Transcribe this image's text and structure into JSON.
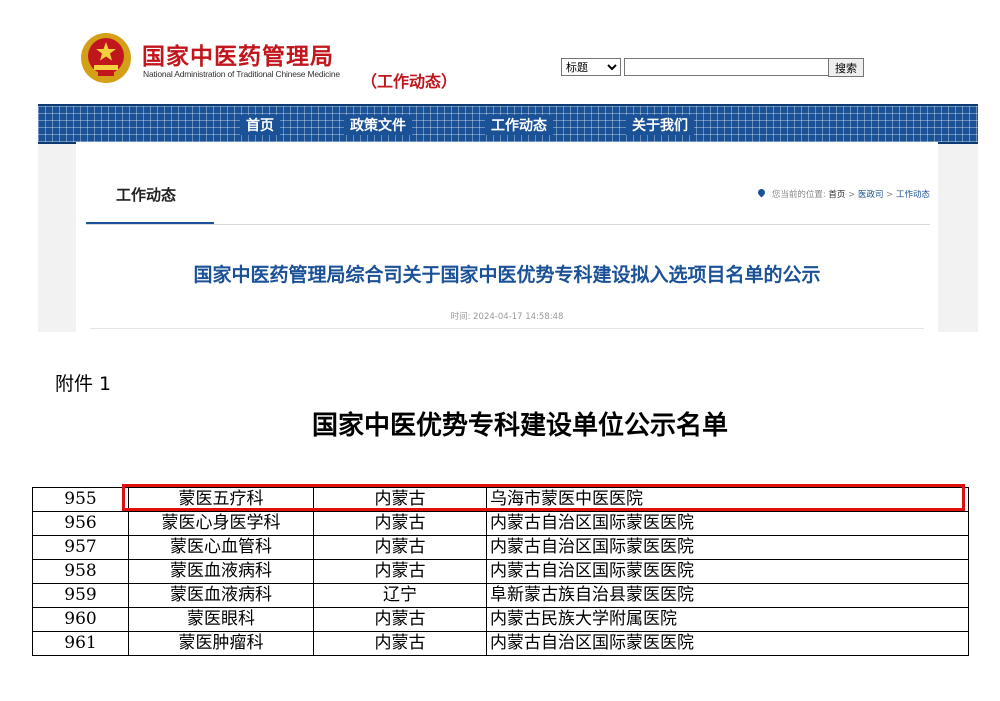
{
  "header": {
    "site_name": "国家中医药管理局",
    "site_name_en": "National Administration of Traditional Chinese Medicine",
    "section_tag": "（工作动态）"
  },
  "search": {
    "select_value": "标题",
    "input_value": "",
    "button_label": "搜索"
  },
  "nav": {
    "items": [
      "首页",
      "政策文件",
      "工作动态",
      "关于我们"
    ]
  },
  "breadcrumb": {
    "section_title": "工作动态",
    "location_prefix": "您当前的位置:",
    "path": [
      "首页",
      "医政司",
      "工作动态"
    ],
    "separator": ">"
  },
  "article": {
    "title": "国家中医药管理局综合司关于国家中医优势专科建设拟入选项目名单的公示",
    "time_label": "时间:",
    "time_value": "2024-04-17 14:58:48"
  },
  "document": {
    "attachment_label": "附件 1",
    "title": "国家中医优势专科建设单位公示名单",
    "rows": [
      {
        "num": "955",
        "dept": "蒙医五疗科",
        "prov": "内蒙古",
        "inst": "乌海市蒙医中医医院"
      },
      {
        "num": "956",
        "dept": "蒙医心身医学科",
        "prov": "内蒙古",
        "inst": "内蒙古自治区国际蒙医医院"
      },
      {
        "num": "957",
        "dept": "蒙医心血管科",
        "prov": "内蒙古",
        "inst": "内蒙古自治区国际蒙医医院"
      },
      {
        "num": "958",
        "dept": "蒙医血液病科",
        "prov": "内蒙古",
        "inst": "内蒙古自治区国际蒙医医院"
      },
      {
        "num": "959",
        "dept": "蒙医血液病科",
        "prov": "辽宁",
        "inst": "阜新蒙古族自治县蒙医医院"
      },
      {
        "num": "960",
        "dept": "蒙医眼科",
        "prov": "内蒙古",
        "inst": "内蒙古民族大学附属医院"
      },
      {
        "num": "961",
        "dept": "蒙医肿瘤科",
        "prov": "内蒙古",
        "inst": "内蒙古自治区国际蒙医医院"
      }
    ]
  },
  "colors": {
    "brand_red": "#c0161c",
    "nav_blue": "#1b5196",
    "highlight_red": "#e01010"
  }
}
